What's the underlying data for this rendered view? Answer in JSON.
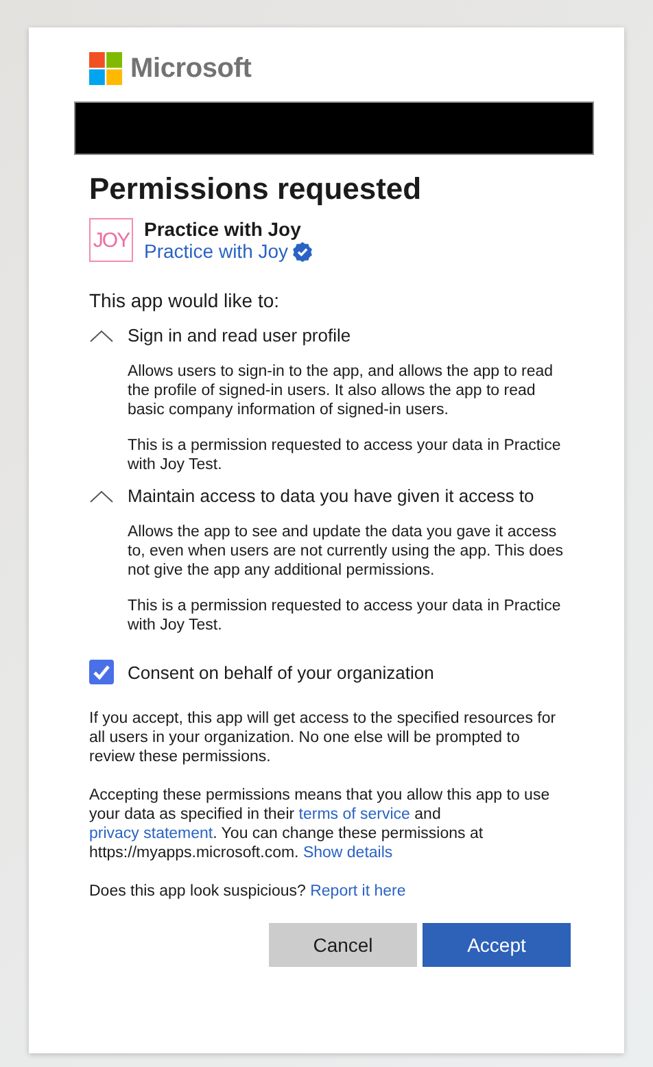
{
  "brand": {
    "name": "Microsoft"
  },
  "heading": "Permissions requested",
  "app": {
    "logo_text": "JOY",
    "name": "Practice with Joy",
    "publisher": "Practice with Joy",
    "verified": true
  },
  "intro": "This app would like to:",
  "permissions": [
    {
      "title": "Sign in and read user profile",
      "expanded": true,
      "paragraphs": [
        "Allows users to sign-in to the app, and allows the app to read the profile of signed-in users. It also allows the app to read basic company information of signed-in users.",
        "This is a permission requested to access your data in Practice with Joy Test."
      ]
    },
    {
      "title": "Maintain access to data you have given it access to",
      "expanded": true,
      "paragraphs": [
        "Allows the app to see and update the data you gave it access to, even when users are not currently using the app. This does not give the app any additional permissions.",
        "This is a permission requested to access your data in Practice with Joy Test."
      ]
    }
  ],
  "consent": {
    "label": "Consent on behalf of your organization",
    "checked": true
  },
  "notes": [
    [
      {
        "kind": "text",
        "text": "If you accept, this app will get access to the specified resources for all users in your organization. No one else will be prompted to review these permissions."
      }
    ],
    [
      {
        "kind": "text",
        "text": "Accepting these permissions means that you allow this app to use your data as specified in their "
      },
      {
        "kind": "link",
        "text": "terms of service"
      },
      {
        "kind": "text",
        "text": " and "
      },
      {
        "kind": "link",
        "text": "privacy statement"
      },
      {
        "kind": "text",
        "text": ". You can change these permissions at https://myapps.microsoft.com. "
      },
      {
        "kind": "link",
        "text": "Show details"
      }
    ],
    [
      {
        "kind": "text",
        "text": "Does this app look suspicious? "
      },
      {
        "kind": "link",
        "text": "Report it here"
      }
    ]
  ],
  "buttons": [
    {
      "label": "Cancel",
      "kind": "secondary"
    },
    {
      "label": "Accept",
      "kind": "primary"
    }
  ]
}
